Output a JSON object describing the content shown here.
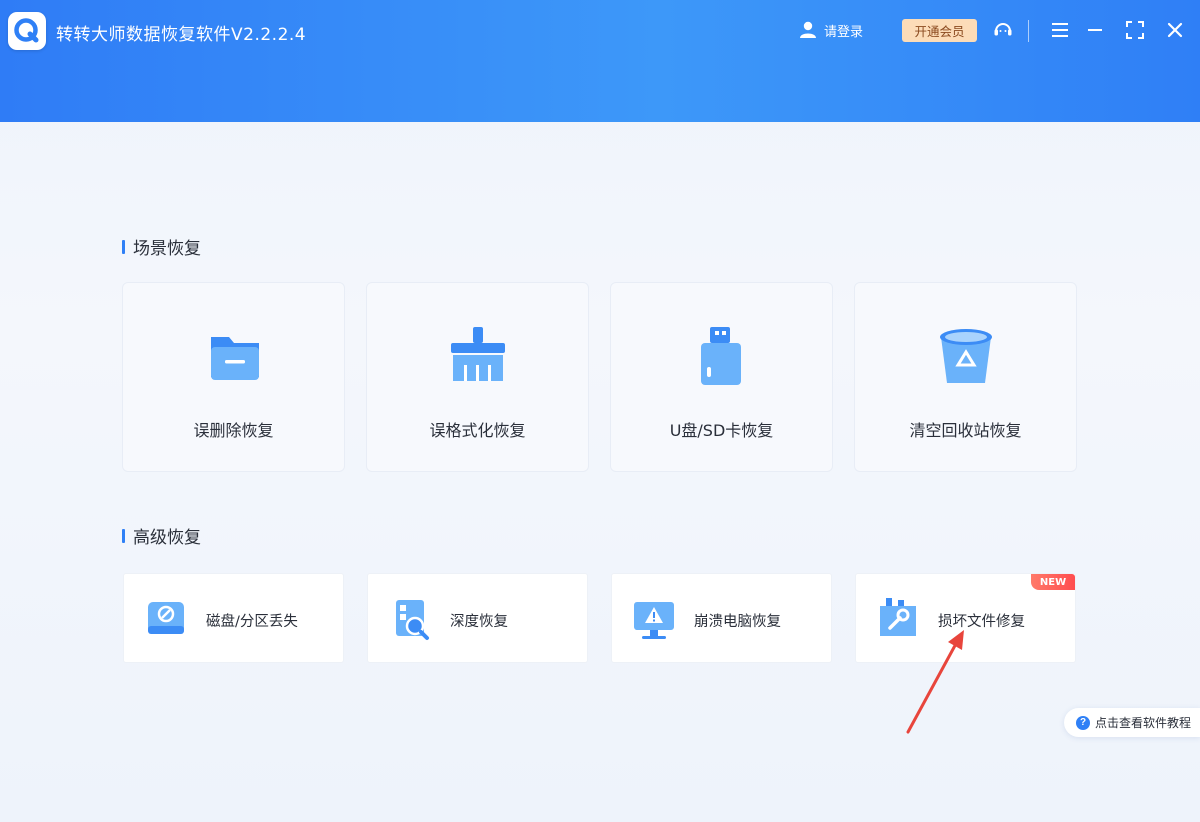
{
  "window": {
    "title": "转转大师数据恢复软件V2.2.2.4",
    "login_label": "请登录",
    "vip_label": "开通会员"
  },
  "sections": {
    "scene_title": "场景恢复",
    "advanced_title": "高级恢复"
  },
  "scene_cards": [
    {
      "label": "误删除恢复",
      "icon": "folder-icon"
    },
    {
      "label": "误格式化恢复",
      "icon": "broom-icon"
    },
    {
      "label": "U盘/SD卡恢复",
      "icon": "usb-drive-icon"
    },
    {
      "label": "清空回收站恢复",
      "icon": "recycle-bin-icon"
    }
  ],
  "advanced_cards": [
    {
      "label": "磁盘/分区丢失",
      "icon": "disk-icon"
    },
    {
      "label": "深度恢复",
      "icon": "deep-scan-icon"
    },
    {
      "label": "崩溃电脑恢复",
      "icon": "crashed-monitor-icon"
    },
    {
      "label": "损坏文件修复",
      "icon": "file-repair-icon",
      "badge": "NEW"
    }
  ],
  "help": {
    "label": "点击查看软件教程"
  },
  "colors": {
    "header_start": "#2f7cf6",
    "header_end": "#3d98f9",
    "accent": "#2f80f6",
    "vip_bg": "#fcdcb8",
    "badge": "#ff4d4f",
    "arrow": "#e8453c"
  }
}
